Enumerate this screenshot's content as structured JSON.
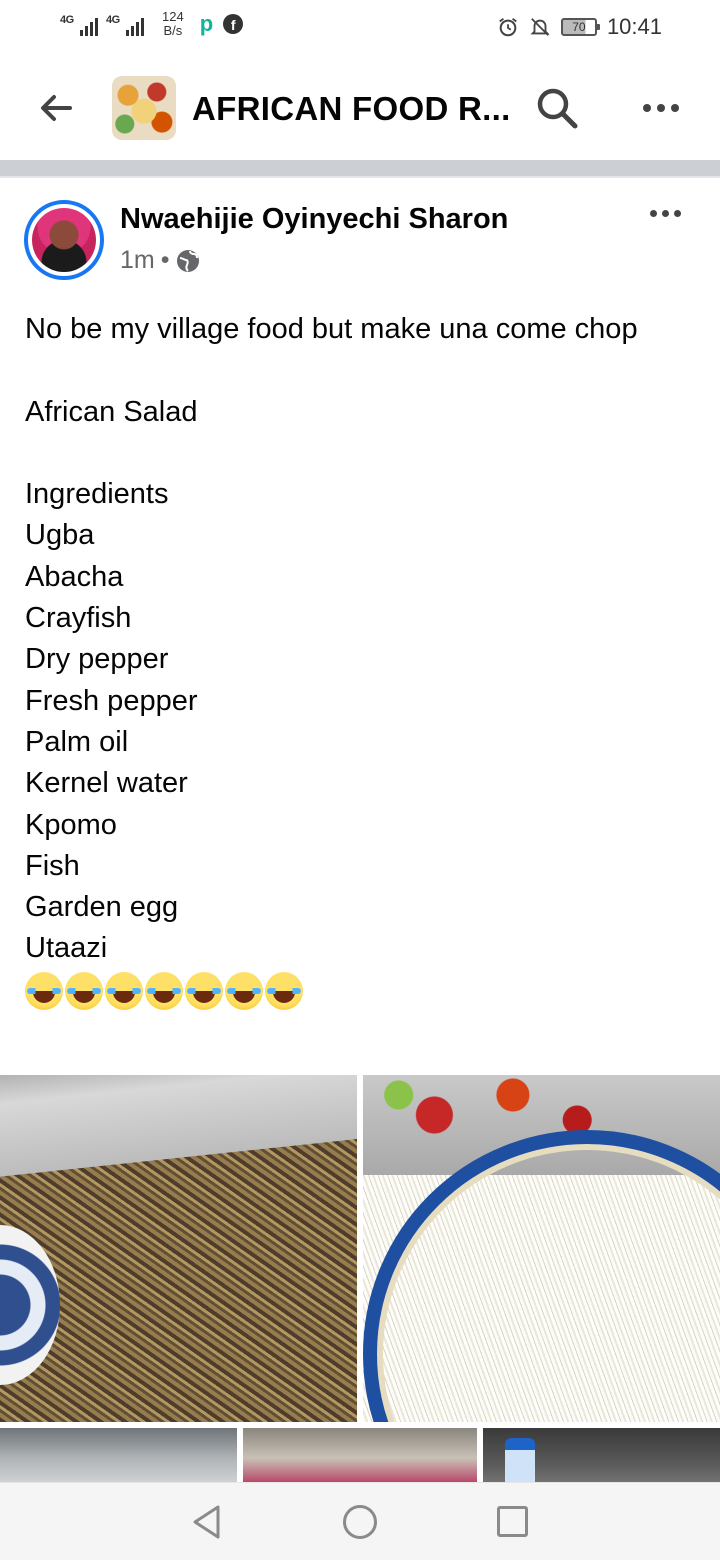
{
  "status_bar": {
    "network_1": "4G",
    "network_2": "4G",
    "speed_value": "124",
    "speed_unit": "B/s",
    "battery": "70",
    "time": "10:41"
  },
  "header": {
    "title": "AFRICAN FOOD R...",
    "icons": [
      "back-arrow-icon",
      "search-icon",
      "more-icon"
    ]
  },
  "post": {
    "author": "Nwaehijie Oyinyechi Sharon",
    "time": "1m",
    "separator": "•",
    "privacy_icon": "globe-icon",
    "lines": [
      "No be my village food but make una come chop",
      "",
      "African Salad",
      "",
      "Ingredients",
      "Ugba",
      "Abacha",
      "Crayfish",
      "Dry pepper",
      "Fresh pepper",
      "Palm oil",
      "Kernel water",
      "Kpomo",
      "Fish",
      "Garden egg",
      "Utaazi"
    ],
    "emoji_count": 7,
    "emoji_name": "face-with-tears-of-joy",
    "photo_count": 5
  },
  "nav": {
    "icons": [
      "nav-back-icon",
      "nav-home-icon",
      "nav-recents-icon"
    ]
  },
  "colors": {
    "accent": "#1877f2",
    "separator": "#ccd0d5",
    "meta_text": "#65676b"
  }
}
